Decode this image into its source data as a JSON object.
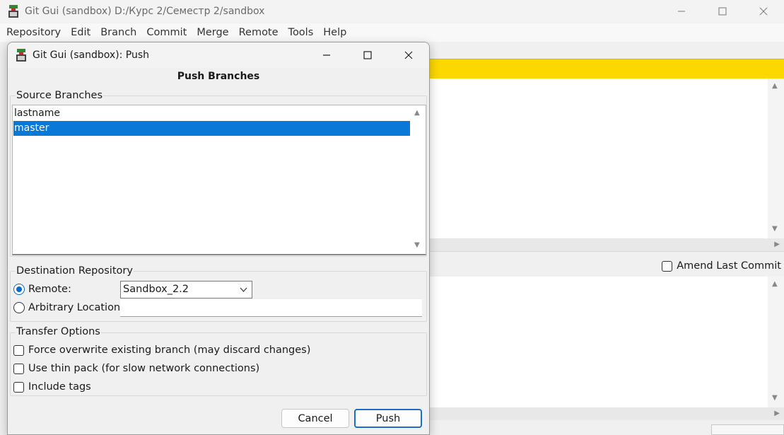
{
  "main_window": {
    "title": "Git Gui (sandbox) D:/Курс 2/Семестр 2/sandbox",
    "menu": [
      "Repository",
      "Edit",
      "Branch",
      "Commit",
      "Merge",
      "Remote",
      "Tools",
      "Help"
    ],
    "amend_label": "Amend Last Commit",
    "amend_checked": false,
    "status_color": "#fcd800"
  },
  "dialog": {
    "title": "Git Gui (sandbox): Push",
    "heading": "Push Branches",
    "source_branches": {
      "label": "Source Branches",
      "items": [
        "lastname",
        "master"
      ],
      "selected": "master"
    },
    "destination": {
      "label": "Destination Repository",
      "remote_label": "Remote:",
      "remote_value": "Sandbox_2.2",
      "arbitrary_label": "Arbitrary Location:",
      "arbitrary_value": "",
      "selected_option": "remote"
    },
    "transfer_options": {
      "label": "Transfer Options",
      "force": "Force overwrite existing branch (may discard changes)",
      "thin_pack": "Use thin pack (for slow network connections)",
      "tags": "Include tags"
    },
    "buttons": {
      "cancel": "Cancel",
      "push": "Push"
    }
  },
  "colors": {
    "selection": "#0a78d7",
    "default_button_border": "#1a6fc4"
  }
}
